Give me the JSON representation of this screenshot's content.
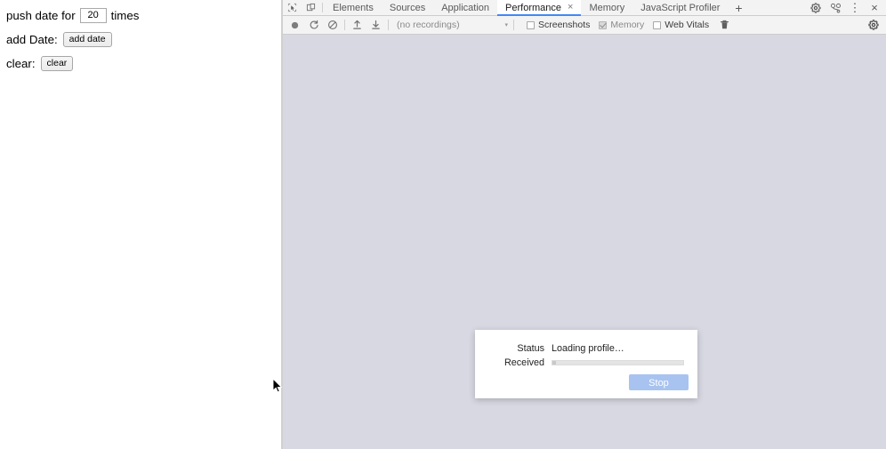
{
  "page": {
    "lines": [
      {
        "prefix": "push date for",
        "input_value": "20",
        "suffix": "times"
      },
      {
        "prefix": "add Date:",
        "button_label": "add date"
      },
      {
        "prefix": "clear:",
        "button_label": "clear"
      }
    ],
    "push_prefix": "push date for",
    "push_input_value": "20",
    "push_suffix": "times",
    "add_label": "add Date:",
    "add_button": "add date",
    "clear_label": "clear:",
    "clear_button": "clear"
  },
  "devtools": {
    "left_icons": [
      {
        "name": "inspect-element-icon"
      },
      {
        "name": "device-toolbar-icon"
      }
    ],
    "tabs": [
      {
        "label": "Elements",
        "active": false,
        "closable": false
      },
      {
        "label": "Sources",
        "active": false,
        "closable": false
      },
      {
        "label": "Application",
        "active": false,
        "closable": false
      },
      {
        "label": "Performance",
        "active": true,
        "closable": true,
        "close_glyph": "×"
      },
      {
        "label": "Memory",
        "active": false,
        "closable": false
      },
      {
        "label": "JavaScript Profiler",
        "active": false,
        "closable": false
      }
    ],
    "more_tabs_glyph": "+",
    "right_icons": [
      {
        "name": "settings-gear-icon"
      },
      {
        "name": "devtools-customize-icon"
      },
      {
        "name": "more-options-icon",
        "glyph": "⋮"
      },
      {
        "name": "close-devtools-icon",
        "glyph": "×"
      }
    ],
    "toolbar": {
      "record_title": "record",
      "reload_title": "reload-and-record",
      "clear_title": "clear-recording",
      "load_title": "load-profile",
      "save_title": "save-profile",
      "recordings_value": "(no recordings)",
      "recordings_caret": "▾",
      "checkboxes": [
        {
          "label": "Screenshots",
          "checked": false,
          "disabled": false
        },
        {
          "label": "Memory",
          "checked": true,
          "disabled": true
        },
        {
          "label": "Web Vitals",
          "checked": false,
          "disabled": false
        }
      ],
      "trash_title": "collect-garbage",
      "capture_settings_title": "capture-settings"
    },
    "dialog": {
      "status_label": "Status",
      "status_value": "Loading profile…",
      "received_label": "Received",
      "progress_percent": 3,
      "stop_label": "Stop"
    }
  },
  "colors": {
    "accent_tab_underline": "#4387f5",
    "panel_background": "#d8d8e2",
    "stop_button": "#a8c3ef",
    "toolbar_background": "#f3f3f3"
  }
}
